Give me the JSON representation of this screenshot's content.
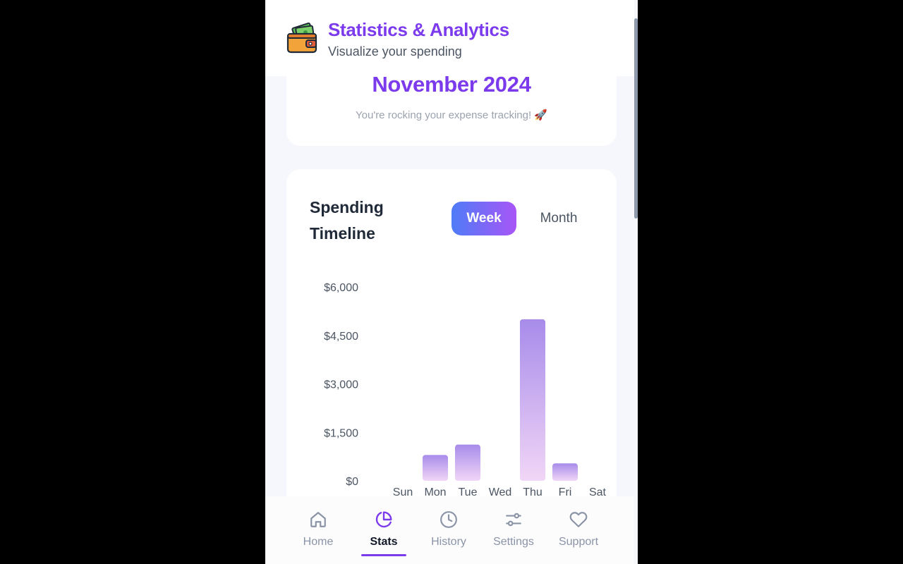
{
  "header": {
    "title": "Statistics & Analytics",
    "subtitle": "Visualize your spending",
    "logo_icon": "wallet-icon"
  },
  "summary": {
    "month": "November 2024",
    "message": "You're rocking your expense tracking! 🚀"
  },
  "timeline": {
    "title": "Spending Timeline",
    "toggle": {
      "week_label": "Week",
      "month_label": "Month",
      "selected": "Week"
    }
  },
  "chart_data": {
    "type": "bar",
    "categories": [
      "Sun",
      "Mon",
      "Tue",
      "Wed",
      "Thu",
      "Fri",
      "Sat"
    ],
    "values": [
      0,
      800,
      1120,
      0,
      5000,
      540,
      0
    ],
    "y_ticks": [
      "$6,000",
      "$4,500",
      "$3,000",
      "$1,500",
      "$0"
    ],
    "ylim": [
      0,
      6000
    ],
    "grid": false,
    "colors": {
      "bar_top": "#a78bea",
      "bar_bottom": "#f1d6f7"
    }
  },
  "nav": {
    "items": [
      {
        "label": "Home",
        "icon": "home-icon"
      },
      {
        "label": "Stats",
        "icon": "pie-chart-icon"
      },
      {
        "label": "History",
        "icon": "clock-icon"
      },
      {
        "label": "Settings",
        "icon": "sliders-icon"
      },
      {
        "label": "Support",
        "icon": "heart-icon"
      }
    ],
    "active": "Stats"
  },
  "colors": {
    "accent": "#7c3aed",
    "text_dark": "#1f2937",
    "muted": "#9ca3af"
  }
}
